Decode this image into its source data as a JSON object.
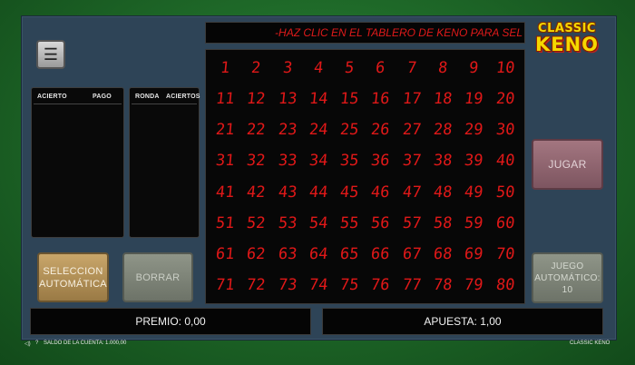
{
  "ticker": {
    "text": "-HAZ CLIC EN EL TABLERO DE KENO PARA SEL"
  },
  "logo": {
    "line1": "CLASSIC",
    "line2": "KENO"
  },
  "menu": {
    "icon": "hamburger-icon",
    "glyph": "☰"
  },
  "paytable": {
    "col1": "ACIERTO",
    "col2": "PAGO",
    "rows": []
  },
  "history": {
    "col1": "RONDA",
    "col2": "ACIERTOS",
    "rows": []
  },
  "board": {
    "color": "#e01818",
    "numbers": [
      1,
      2,
      3,
      4,
      5,
      6,
      7,
      8,
      9,
      10,
      11,
      12,
      13,
      14,
      15,
      16,
      17,
      18,
      19,
      20,
      21,
      22,
      23,
      24,
      25,
      26,
      27,
      28,
      29,
      30,
      31,
      32,
      33,
      34,
      35,
      36,
      37,
      38,
      39,
      40,
      41,
      42,
      43,
      44,
      45,
      46,
      47,
      48,
      49,
      50,
      51,
      52,
      53,
      54,
      55,
      56,
      57,
      58,
      59,
      60,
      61,
      62,
      63,
      64,
      65,
      66,
      67,
      68,
      69,
      70,
      71,
      72,
      73,
      74,
      75,
      76,
      77,
      78,
      79,
      80
    ]
  },
  "buttons": {
    "auto_select_line1": "SELECCION",
    "auto_select_line2": "AUTOMÁTICA",
    "clear": "BORRAR",
    "play": "JUGAR",
    "autoplay_line1": "JUEGO",
    "autoplay_line2": "AUTOMÁTICO:",
    "autoplay_count": "10"
  },
  "prize": {
    "label": "PREMIO:",
    "value": "0,00"
  },
  "bet": {
    "label": "APUESTA:",
    "value": "1,00"
  },
  "status": {
    "sound_icon": "speaker-icon",
    "help_glyph": "?",
    "balance_label": "SALDO DE LA CUENTA:",
    "balance_value": "1.000,00",
    "game_name": "CLASSIC KENO"
  }
}
